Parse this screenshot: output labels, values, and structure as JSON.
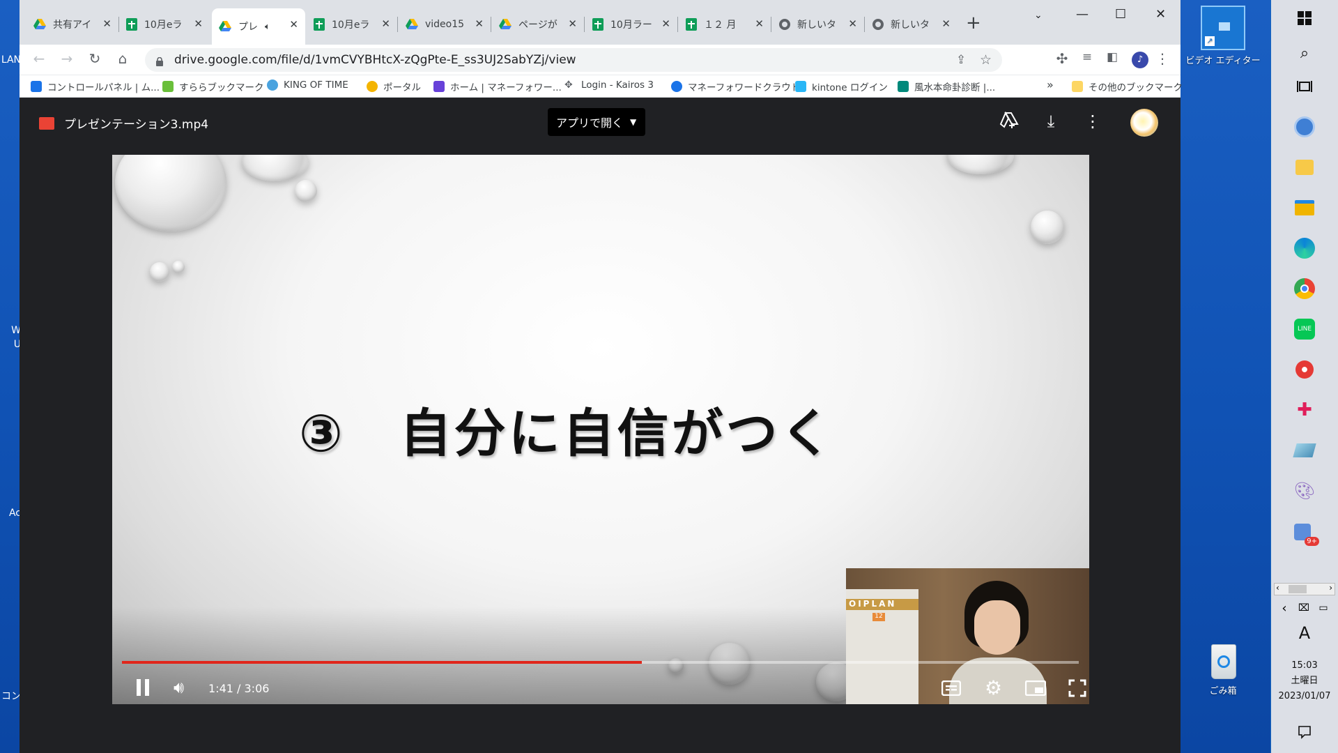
{
  "desktop": {
    "left_labels": [
      "LAN",
      "W",
      "U",
      "Ac",
      "コン"
    ],
    "video_editor_label": "ビデオ エディター",
    "recycle_bin_label": "ごみ箱"
  },
  "tabs": [
    {
      "title": "共有アイ",
      "favicon": "drive-icon"
    },
    {
      "title": "10月eラ",
      "favicon": "sheets-icon"
    },
    {
      "title": "プレ",
      "favicon": "drive-icon",
      "active": true,
      "audio": "speaker-icon"
    },
    {
      "title": "10月eラ",
      "favicon": "sheets-icon"
    },
    {
      "title": "video15",
      "favicon": "drive-icon"
    },
    {
      "title": "ページが",
      "favicon": "drive-icon"
    },
    {
      "title": "10月ラー",
      "favicon": "sheets-icon"
    },
    {
      "title": "１２ 月",
      "favicon": "sheets-icon"
    },
    {
      "title": "新しいタ",
      "favicon": "chrome-icon"
    },
    {
      "title": "新しいタ",
      "favicon": "chrome-icon"
    }
  ],
  "toolbar": {
    "url": "drive.google.com/file/d/1vmCVYBHtcX-zQgPte-E_ss3UJ2SabYZj/view"
  },
  "bookmarks": [
    {
      "label": "コントロールパネル | ム...",
      "color": "#1a73e8"
    },
    {
      "label": "すららブックマーク",
      "color": "#6abf3a"
    },
    {
      "label": "KING OF TIME",
      "color": "#4aa3df"
    },
    {
      "label": "ポータル",
      "color": "#f4b400"
    },
    {
      "label": "ホーム | マネーフォワー...",
      "color": "#6741d9"
    },
    {
      "label": "Login - Kairos 3",
      "color": "#5f6368"
    },
    {
      "label": "マネーフォワードクラウド",
      "color": "#1a73e8"
    },
    {
      "label": "kintone ログイン",
      "color": "#29b6f6"
    },
    {
      "label": "風水本命卦診断 |...",
      "color": "#00897b"
    }
  ],
  "bookmarks_more": "»",
  "bookmarks_other": "その他のブックマーク",
  "viewer": {
    "file_name": "プレゼンテーション3.mp4",
    "open_with": "アプリで開く",
    "slide_title": "③　自分に自信がつく",
    "webcam_calendar_band": "OIPLAN",
    "webcam_calendar_month": "12",
    "time_display": "1:41 / 3:06",
    "progress_fraction": 0.543
  },
  "panel": {
    "ime": "A",
    "time": "15:03",
    "weekday": "土曜日",
    "date": "2023/01/07",
    "notification_badge": "9+"
  },
  "colors": {
    "progress": "#e0261b",
    "desktop": "#1565c0",
    "viewer_bg": "#202124"
  }
}
